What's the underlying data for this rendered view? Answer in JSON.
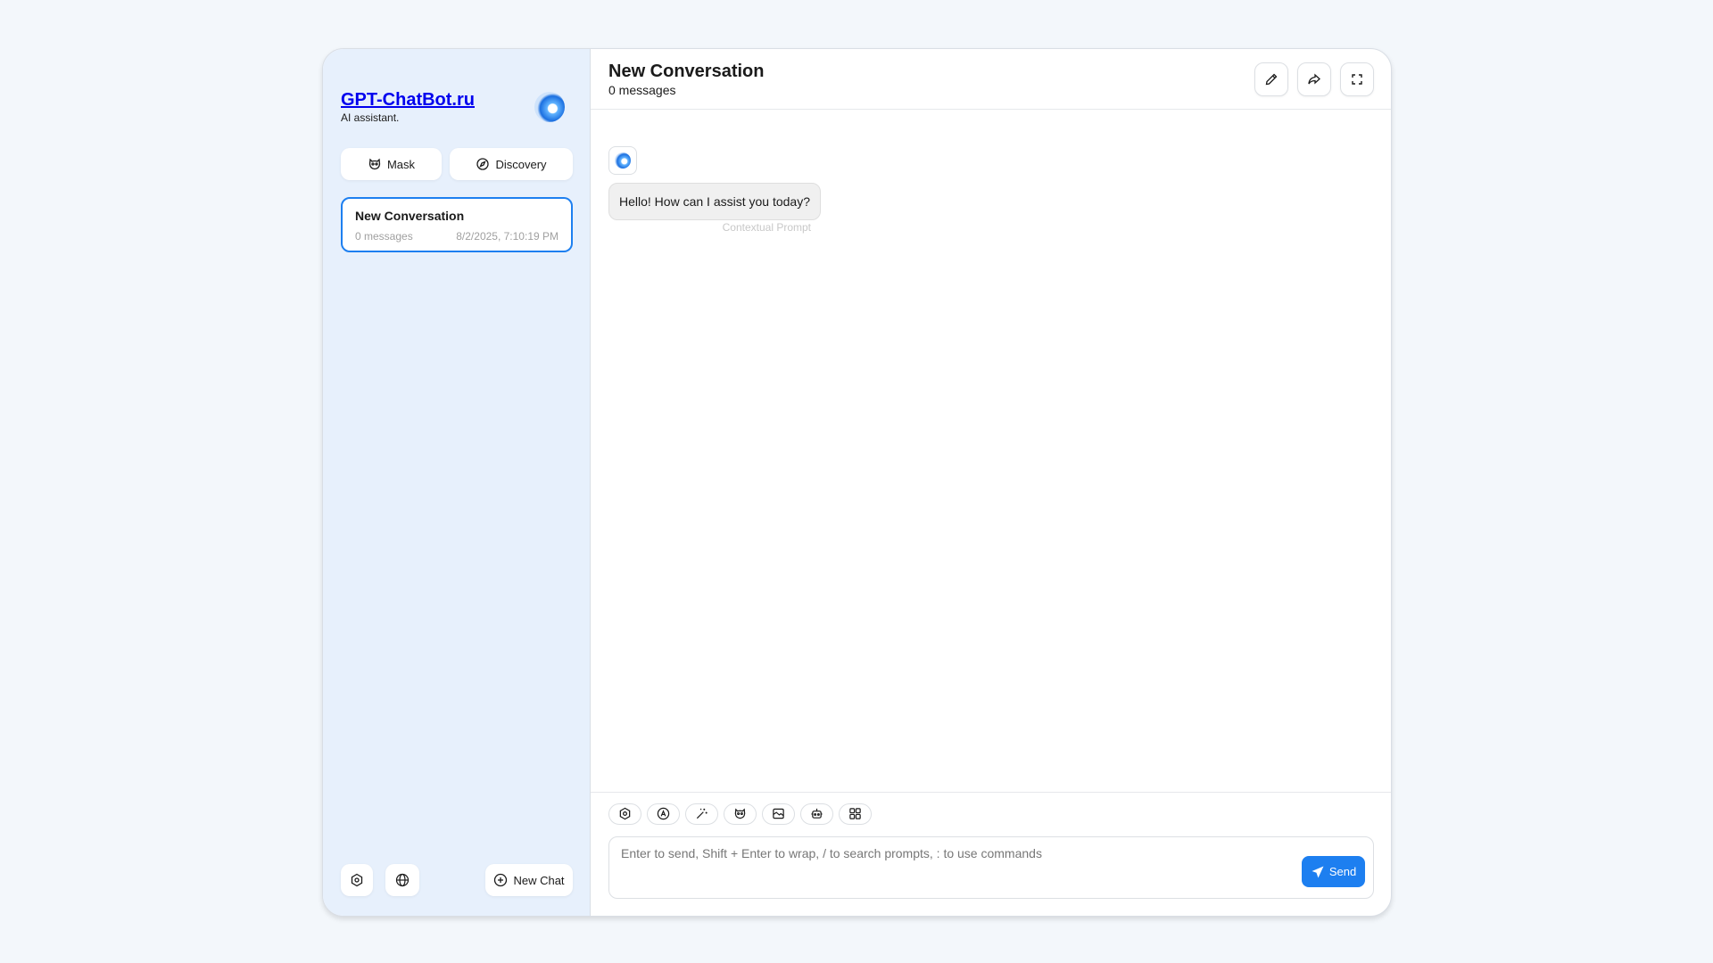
{
  "sidebar": {
    "brand_title": "GPT-ChatBot.ru",
    "brand_subtitle": "AI assistant.",
    "mask_label": "Mask",
    "discovery_label": "Discovery",
    "chats": [
      {
        "title": "New Conversation",
        "count": "0 messages",
        "date": "8/2/2025, 7:10:19 PM"
      }
    ],
    "new_chat_label": "New Chat"
  },
  "header": {
    "title": "New Conversation",
    "subtitle": "0 messages"
  },
  "messages": [
    {
      "role": "assistant",
      "text": "Hello! How can I assist you today?",
      "meta": "Contextual Prompt"
    }
  ],
  "composer": {
    "placeholder": "Enter to send, Shift + Enter to wrap, / to search prompts, : to use commands",
    "send_label": "Send",
    "tools": [
      "settings-icon",
      "model-icon",
      "magic-wand-icon",
      "mask-icon",
      "image-icon",
      "robot-icon",
      "plugins-grid-icon"
    ]
  },
  "colors": {
    "accent": "#1d7ff0",
    "sidebar_bg": "#e7f0fc",
    "page_bg": "#f3f7fb"
  }
}
